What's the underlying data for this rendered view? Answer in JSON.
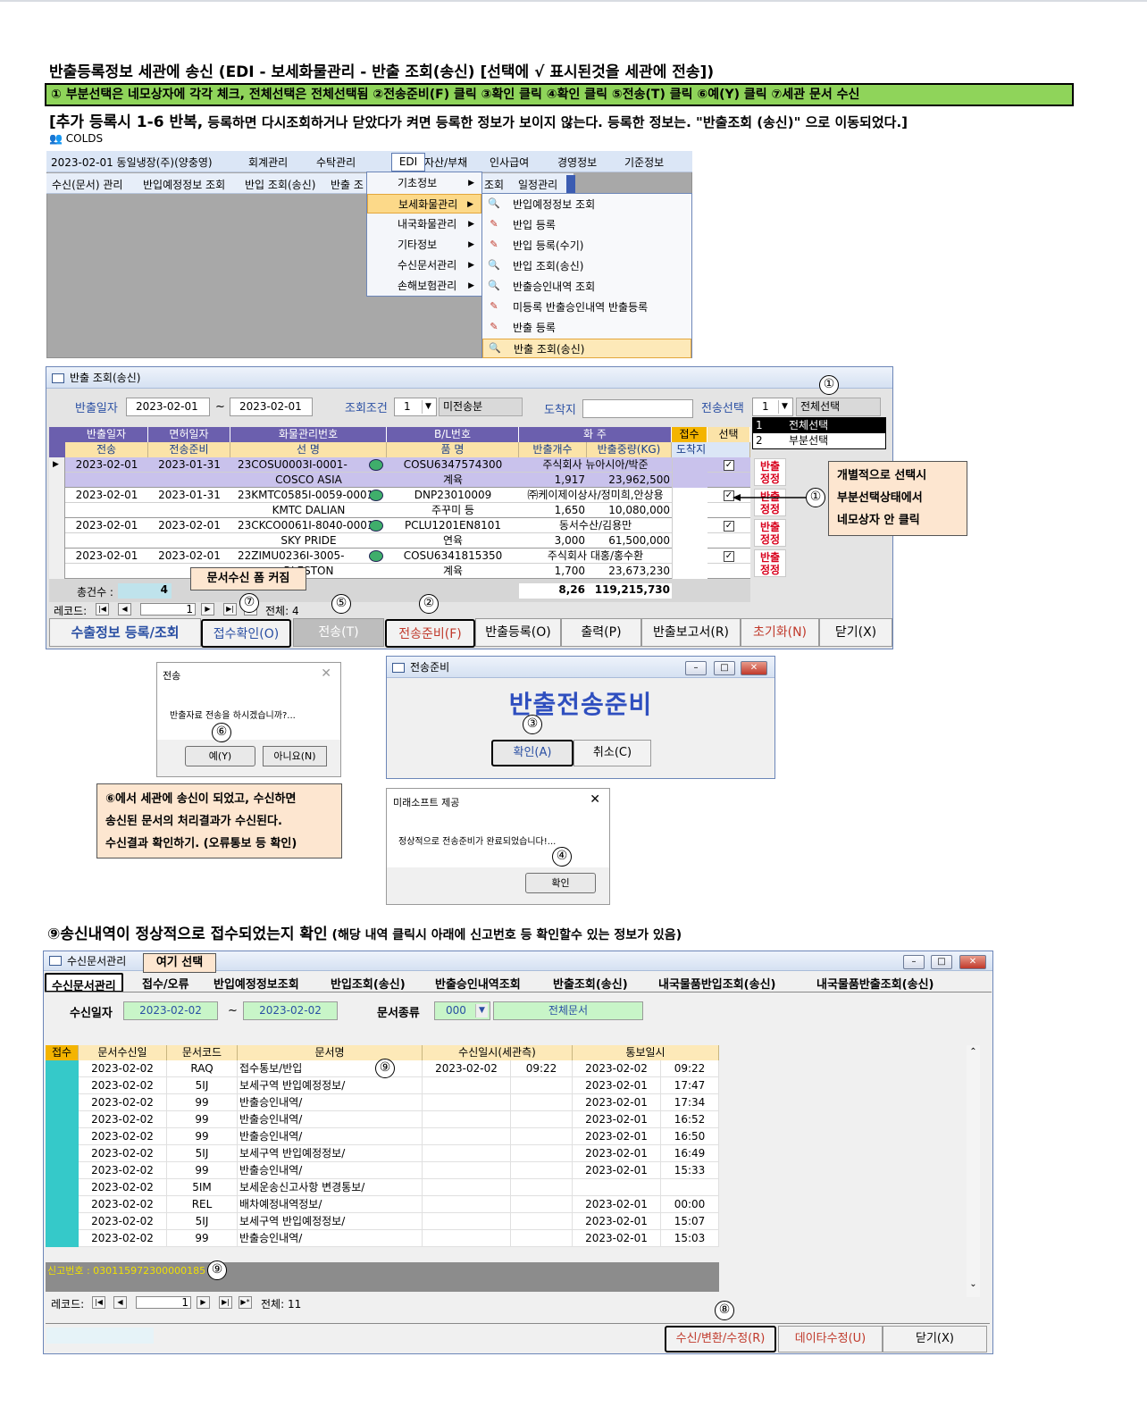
{
  "instructions": {
    "title": "반출등록정보 세관에 송신 (EDI - 보세화물관리 - 반출 조회(송신) [선택에 √ 표시된것을 세관에 전송])",
    "steps": "① 부분선택은 네모상자에 각각 체크, 전체선택은 전체선택됨 ②전송준비(F) 클릭 ③확인 클릭 ④확인 클릭 ⑤전송(T) 클릭 ⑥예(Y) 클릭 ⑦세관 문서 수신",
    "note_bold": "[추가 등록시 1-6 반복,",
    "note_rest": " 등록하면 다시조회하거나 닫았다가 켜면 등록한 정보가 보이지 않는다. 등록한 정보는. \"반출조회 (송신)\" 으로 이동되었다.]",
    "app_label": "COLDS"
  },
  "menu_window": {
    "menubar": [
      "2023-02-01 동일냉장(주)(양충영)",
      "회계관리",
      "수탁관리",
      "EDI",
      "자산/부채",
      "인사급여",
      "경영정보",
      "기준정보"
    ],
    "toolbar": [
      "수신(문서) 관리",
      "반입예정정보 조회",
      "반입 조회(송신)",
      "반출 조",
      "조회",
      "일정관리"
    ],
    "edi_dropdown": [
      "기초정보",
      "보세화물관리",
      "내국화물관리",
      "기타정보",
      "수신문서관리",
      "손해보험관리"
    ],
    "bonded_submenu": [
      "반입예정정보 조회",
      "반입 등록",
      "반입 등록(수기)",
      "반입 조회(송신)",
      "반출승인내역 조회",
      "미등록 반출승인내역 반출등록",
      "반출 등록",
      "반출 조회(송신)"
    ]
  },
  "release_window": {
    "title": "반출 조회(송신)",
    "date_label": "반출일자",
    "date_from": "2023-02-01",
    "tilde": "~",
    "date_to": "2023-02-01",
    "cond_label": "조회조건",
    "cond_value": "1",
    "cond_text": "미전송분",
    "dest_label": "도착지",
    "send_label": "전송선택",
    "send_value": "1",
    "send_text": "전체선택",
    "send_options": [
      {
        "code": "1",
        "label": "전체선택"
      },
      {
        "code": "2",
        "label": "부분선택"
      }
    ],
    "header1": [
      "반출일자",
      "면허일자",
      "화물관리번호",
      "B/L번호",
      "화      주",
      "접수",
      "선택"
    ],
    "header2": [
      "전송",
      "전송준비",
      "선      명",
      "품      명",
      "반출개수",
      "반출중량(KG)",
      "도착지"
    ],
    "rows": [
      {
        "date": "2023-02-01",
        "lic": "2023-01-31",
        "cargo": "23COSU0003I-0001-",
        "bl": "COSU6347574300",
        "owner": "주식회사 뉴아시아/박준",
        "ship": "COSCO ASIA",
        "item": "계육",
        "qty": "1,917",
        "weight": "23,962,500",
        "btn": "반출\n정정"
      },
      {
        "date": "2023-02-01",
        "lic": "2023-01-31",
        "cargo": "23KMTC0585I-0059-0001",
        "bl": "DNP23010009",
        "owner": "㈜케이제이상사/정미희,안상용",
        "ship": "KMTC DALIAN",
        "item": "주꾸미 등",
        "qty": "1,650",
        "weight": "10,080,000",
        "btn": "반출\n정정"
      },
      {
        "date": "2023-02-01",
        "lic": "2023-02-01",
        "cargo": "23CKCO0061I-8040-0001",
        "bl": "PCLU1201EN8101",
        "owner": "동서수산/김용만",
        "ship": "SKY PRIDE",
        "item": "연육",
        "qty": "3,000",
        "weight": "61,500,000",
        "btn": "반출\n정정"
      },
      {
        "date": "2023-02-01",
        "lic": "2023-02-01",
        "cargo": "22ZIMU0236I-3005-",
        "bl": "COSU6341815350",
        "owner": "주식회사 대홍/홍수환",
        "ship": "RLESTON",
        "item": "계육",
        "qty": "1,700",
        "weight": "23,673,230",
        "btn": "반출\n정정"
      }
    ],
    "total_label": "총건수 :",
    "total_count": "4",
    "total_qty": "8,26",
    "total_weight": "119,215,730",
    "record_label": "레코드:",
    "record_pos": "1",
    "record_total": "전체: 4",
    "popup_note": "문서수신 폼 커짐",
    "buttons": [
      "수출정보 등록/조회",
      "접수확인(O)",
      "전송(T)",
      "전송준비(F)",
      "반출등록(O)",
      "출력(P)",
      "반출보고서(R)",
      "초기화(N)",
      "닫기(X)"
    ],
    "callout": [
      "개별적으로 선택시",
      "부분선택상태에서",
      "네모상자 안 클릭"
    ]
  },
  "send_dialog": {
    "title": "전송",
    "message": "반출자료 전송을 하시겠습니까?...",
    "yes": "예(Y)",
    "no": "아니요(N)"
  },
  "prep_dialog": {
    "title": "전송준비",
    "heading": "반출전송준비",
    "ok": "확인(A)",
    "cancel": "취소(C)"
  },
  "info_dialog": {
    "title": "미래소프트 제공",
    "message": "정상적으로 전송준비가 완료되었습니다!...",
    "ok": "확인"
  },
  "note6": [
    "⑥에서 세관에 송신이 되었고, 수신하면",
    "송신된 문서의 처리결과가 수신된다.",
    "수신결과 확인하기. (오류통보 등 확인)"
  ],
  "section9": {
    "title": "⑨송신내역이 정상적으로 접수되었는지 확인",
    "subtitle": " (해당 내역 클릭시 아래에 신고번호 등 확인할수 있는 정보가 있음)"
  },
  "recv_window": {
    "title": "수신문서관리",
    "callout": "여기 선택",
    "tabs": [
      "수신문서관리",
      "접수/오류",
      "반입예정정보조회",
      "반입조회(송신)",
      "반출승인내역조회",
      "반출조회(송신)",
      "내국물품반입조회(송신)",
      "내국물품반출조회(송신)"
    ],
    "date_label": "수신일자",
    "date_from": "2023-02-02",
    "tilde": "~",
    "date_to": "2023-02-02",
    "doc_label": "문서종류",
    "doc_code": "000",
    "doc_text": "전체문서",
    "headers": [
      "접수",
      "문서수신일",
      "문서코드",
      "문서명",
      "수신일시(세관측)",
      "통보일시"
    ],
    "rows": [
      [
        "2023-02-02",
        "RAQ",
        "접수통보/반입",
        "2023-02-02",
        "09:22",
        "2023-02-02",
        "09:22"
      ],
      [
        "2023-02-02",
        "5IJ",
        "보세구역 반입예정정보/",
        "",
        "",
        "2023-02-01",
        "17:47"
      ],
      [
        "2023-02-02",
        "99",
        "반출승인내역/",
        "",
        "",
        "2023-02-01",
        "17:34"
      ],
      [
        "2023-02-02",
        "99",
        "반출승인내역/",
        "",
        "",
        "2023-02-01",
        "16:52"
      ],
      [
        "2023-02-02",
        "99",
        "반출승인내역/",
        "",
        "",
        "2023-02-01",
        "16:50"
      ],
      [
        "2023-02-02",
        "5IJ",
        "보세구역 반입예정정보/",
        "",
        "",
        "2023-02-01",
        "16:49"
      ],
      [
        "2023-02-02",
        "99",
        "반출승인내역/",
        "",
        "",
        "2023-02-01",
        "15:33"
      ],
      [
        "2023-02-02",
        "5IM",
        "보세운송신고사항 변경통보/",
        "",
        "",
        "",
        ""
      ],
      [
        "2023-02-02",
        "REL",
        "배차예정내역정보/",
        "",
        "",
        "2023-02-01",
        "00:00"
      ],
      [
        "2023-02-02",
        "5IJ",
        "보세구역 반입예정정보/",
        "",
        "",
        "2023-02-01",
        "15:07"
      ],
      [
        "2023-02-02",
        "99",
        "반출승인내역/",
        "",
        "",
        "2023-02-01",
        "15:03"
      ]
    ],
    "declaration": "신고번호 : 030115972300000185",
    "record_label": "레코드:",
    "record_pos": "1",
    "record_total": "전체: 11",
    "buttons": [
      "수신/변환/수정(R)",
      "데이타수정(U)",
      "닫기(X)"
    ]
  },
  "markers": [
    "①",
    "②",
    "③",
    "④",
    "⑤",
    "⑥",
    "⑦",
    "⑧",
    "⑨"
  ],
  "colors": {
    "green_bar": "#8fd45a",
    "header_purple": "#6b5fae",
    "header_yellow": "#fbe3a8",
    "teal": "#35c9c9",
    "callout": "#fde6d0",
    "red": "#d8001c"
  }
}
